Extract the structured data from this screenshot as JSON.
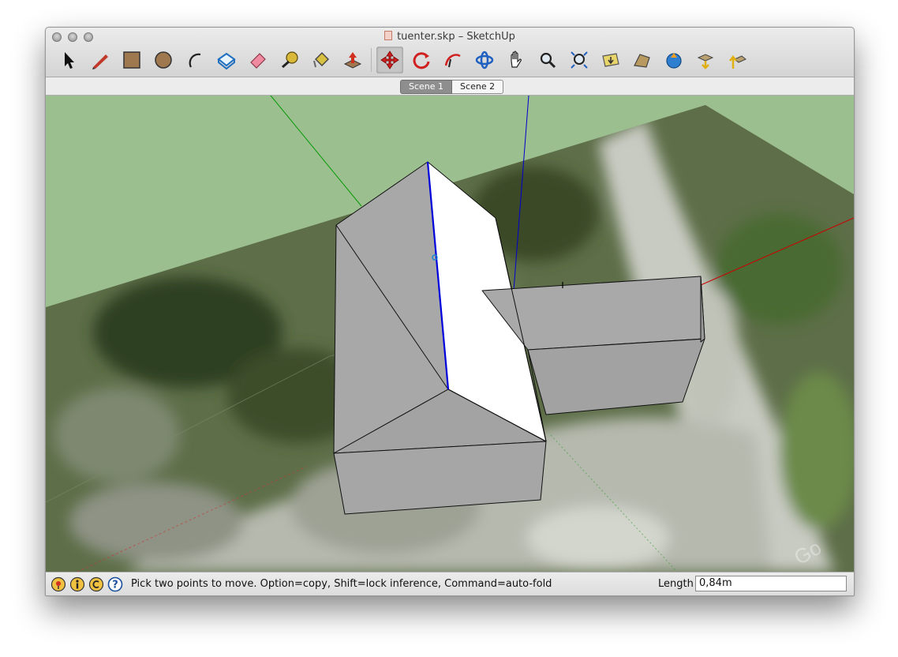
{
  "window": {
    "title": "tuenter.skp – SketchUp"
  },
  "toolbar": {
    "tools": [
      {
        "icon": "select-arrow-icon"
      },
      {
        "icon": "pencil-line-icon"
      },
      {
        "icon": "rectangle-icon"
      },
      {
        "icon": "circle-icon"
      },
      {
        "icon": "arc-icon"
      },
      {
        "icon": "make-component-icon"
      },
      {
        "icon": "eraser-icon"
      },
      {
        "icon": "tape-measure-icon"
      },
      {
        "icon": "paint-bucket-icon"
      },
      {
        "icon": "push-pull-icon"
      },
      {
        "icon": "move-icon"
      },
      {
        "icon": "rotate-icon"
      },
      {
        "icon": "follow-me-icon"
      },
      {
        "icon": "orbit-icon"
      },
      {
        "icon": "pan-hand-icon"
      },
      {
        "icon": "zoom-icon"
      },
      {
        "icon": "zoom-extents-icon"
      },
      {
        "icon": "get-current-view-icon"
      },
      {
        "icon": "toggle-terrain-icon"
      },
      {
        "icon": "add-location-icon"
      },
      {
        "icon": "get-models-icon"
      },
      {
        "icon": "share-model-icon"
      }
    ],
    "active_tool": "move-icon"
  },
  "scenes": {
    "tabs": [
      "Scene 1",
      "Scene 2"
    ],
    "active": "Scene 1"
  },
  "status": {
    "icons": [
      "geo-location-icon",
      "credits-icon",
      "copyright-icon",
      "help-icon"
    ],
    "message": "Pick two points to move.  Option=copy, Shift=lock inference, Command=auto-fold",
    "length_label": "Length",
    "length_value": "0,84m"
  },
  "colors": {
    "ground": "#9cbf90",
    "face_gray": "#a6a6a6",
    "face_white": "#ffffff",
    "axis_red": "#cc0000",
    "axis_green": "#009900",
    "axis_blue": "#0000cc"
  }
}
